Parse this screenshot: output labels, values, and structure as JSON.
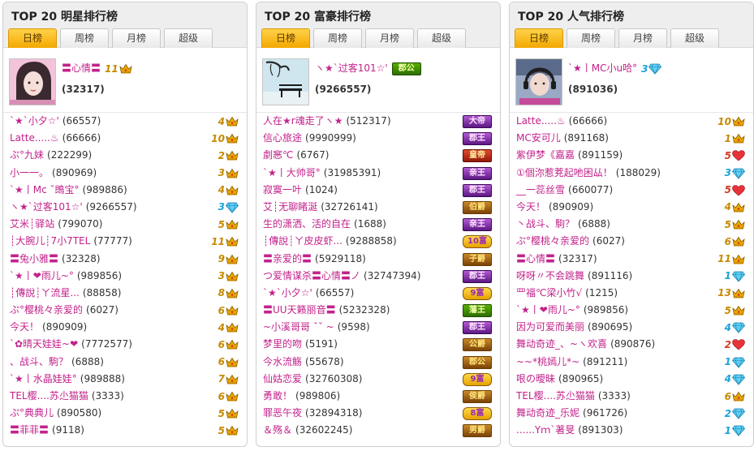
{
  "panels": [
    {
      "title": "TOP 20 明星排行榜",
      "tabs": [
        "日榜",
        "周榜",
        "月榜",
        "超级"
      ],
      "active_tab": 0,
      "top": {
        "name": "〓心情〓",
        "score": "(32317)",
        "level": "11",
        "badge_icon": "crown-icon",
        "avatar": "avatar-girl-pink"
      },
      "rows": [
        {
          "name": "`★`小夕☆'",
          "score": "(66557)",
          "level": "4",
          "icon": "crown-icon"
        },
        {
          "name": "Latte.....♨",
          "score": "(66666)",
          "level": "10",
          "icon": "crown-icon"
        },
        {
          "name": "ぷ°九妹",
          "score": "(222299)",
          "level": "2",
          "icon": "crown-icon"
        },
        {
          "name": "小一一。",
          "score": "(890969)",
          "level": "3",
          "icon": "crown-icon"
        },
        {
          "name": "`★丨Mc ˇ鵖宝°",
          "score": "(989886)",
          "level": "4",
          "icon": "crown-icon"
        },
        {
          "name": "ヽ★`过客101☆'",
          "score": "(9266557)",
          "level": "3",
          "icon": "diamond-icon"
        },
        {
          "name": "艾米┊驿站",
          "score": "(799070)",
          "level": "5",
          "icon": "crown-icon"
        },
        {
          "name": "┊大腕儿┊7小7TEL",
          "score": "(77777)",
          "level": "11",
          "icon": "crown-icon"
        },
        {
          "name": "〓兔小雅〓",
          "score": "(32328)",
          "level": "9",
          "icon": "crown-icon"
        },
        {
          "name": "`★丨❤雨儿~°",
          "score": "(989856)",
          "level": "3",
          "icon": "crown-icon"
        },
        {
          "name": "┊傳說┊ㄚ流星...",
          "score": "(88858)",
          "level": "8",
          "icon": "crown-icon"
        },
        {
          "name": "ぷ°樱桃々亲爱的",
          "score": "(6027)",
          "level": "6",
          "icon": "crown-icon"
        },
        {
          "name": "今天！",
          "score": "(890909)",
          "level": "4",
          "icon": "crown-icon"
        },
        {
          "name": "`✿晴天娃娃~❤",
          "score": "(7772577)",
          "level": "6",
          "icon": "crown-icon"
        },
        {
          "name": "、战斗、駒？",
          "score": "(6888)",
          "level": "6",
          "icon": "crown-icon"
        },
        {
          "name": "`★丨水晶娃娃°",
          "score": "(989888)",
          "level": "7",
          "icon": "crown-icon"
        },
        {
          "name": "TEL樱....苏尐猫猫",
          "score": "(3333)",
          "level": "6",
          "icon": "crown-icon"
        },
        {
          "name": "ぷ°典典儿",
          "score": "(890580)",
          "level": "5",
          "icon": "crown-icon"
        },
        {
          "name": "〓菲菲〓",
          "score": "(9118)",
          "level": "5",
          "icon": "crown-icon"
        }
      ]
    },
    {
      "title": "TOP 20 富豪排行榜",
      "tabs": [
        "日榜",
        "周榜",
        "月榜",
        "超级"
      ],
      "active_tab": 0,
      "top": {
        "name": "ヽ★`过客101☆'",
        "score": "(9266557)",
        "title_badge": "郡公",
        "badge_style": "green",
        "avatar": "avatar-bench-tree"
      },
      "rows": [
        {
          "name": "人在★r魂走了ヽ★",
          "score": "(512317)",
          "badge": "大帝",
          "style": "purple"
        },
        {
          "name": "信心旅途",
          "score": "(9990999)",
          "badge": "郡王",
          "style": "purple"
        },
        {
          "name": "劇窸℃",
          "score": "(6767)",
          "badge": "皇帝",
          "style": "red"
        },
        {
          "name": "`★丨大帅哥°",
          "score": "(31985391)",
          "badge": "亲王",
          "style": "purple"
        },
        {
          "name": "寂寞一叶",
          "score": "(1024)",
          "badge": "郡王",
          "style": "purple"
        },
        {
          "name": "艾┊无聊睹涎",
          "score": "(32726141)",
          "badge": "伯爵",
          "style": "brown"
        },
        {
          "name": "生的潇洒、活的自在",
          "score": "(1688)",
          "badge": "亲王",
          "style": "purple"
        },
        {
          "name": "┊傳說┊ㄚ皮皮虾...",
          "score": "(9288858)",
          "badge": "10富",
          "style": "fancy"
        },
        {
          "name": "〓亲爱的〓",
          "score": "(5929118)",
          "badge": "子爵",
          "style": "brown"
        },
        {
          "name": "つ爱情谋杀〓心情〓ノ",
          "score": "(32747394)",
          "badge": "郡王",
          "style": "purple"
        },
        {
          "name": "`★`小夕☆'",
          "score": "(66557)",
          "badge": "9富",
          "style": "fancy"
        },
        {
          "name": "〓UU天籁丽音〓",
          "score": "(5232328)",
          "badge": "藩王",
          "style": "green"
        },
        {
          "name": "~小溪哥哥 ˇˇ ~",
          "score": "(9598)",
          "badge": "郡王",
          "style": "purple"
        },
        {
          "name": "梦里的吻",
          "score": "(5191)",
          "badge": "公爵",
          "style": "brown"
        },
        {
          "name": "今水流觞",
          "score": "(55678)",
          "badge": "郡公",
          "style": "brown"
        },
        {
          "name": "仙姑恋爱",
          "score": "(32760308)",
          "badge": "9富",
          "style": "fancy"
        },
        {
          "name": "勇敢！",
          "score": "(989806)",
          "badge": "侯爵",
          "style": "brown"
        },
        {
          "name": "罪恶午夜",
          "score": "(32894318)",
          "badge": "8富",
          "style": "fancy"
        },
        {
          "name": "＆殇＆",
          "score": "(32602245)",
          "badge": "男爵",
          "style": "brown"
        }
      ]
    },
    {
      "title": "TOP 20 人气排行榜",
      "tabs": [
        "日榜",
        "周榜",
        "月榜",
        "超级"
      ],
      "active_tab": 0,
      "top": {
        "name": "`★丨MC小u哈°",
        "score": "(891036)",
        "level": "3",
        "badge_icon": "diamond-icon",
        "avatar": "avatar-girl-headphones"
      },
      "rows": [
        {
          "name": "Latte.....♨",
          "score": "(66666)",
          "level": "10",
          "icon": "crown-icon"
        },
        {
          "name": "MC安可儿",
          "score": "(891168)",
          "level": "1",
          "icon": "crown-icon"
        },
        {
          "name": "紫伊梦《嘉嘉",
          "score": "(891159)",
          "level": "5",
          "icon": "heart-icon"
        },
        {
          "name": "①個沵惹茺起吔困厸！",
          "score": "(188029)",
          "level": "3",
          "icon": "diamond-icon"
        },
        {
          "name": "__一蕊丝雪",
          "score": "(660077)",
          "level": "5",
          "icon": "heart-icon"
        },
        {
          "name": "今天！",
          "score": "(890909)",
          "level": "4",
          "icon": "crown-icon"
        },
        {
          "name": "丶战斗、駒？",
          "score": "(6888)",
          "level": "5",
          "icon": "crown-icon"
        },
        {
          "name": "ぷ°樱桃々亲爱的",
          "score": "(6027)",
          "level": "6",
          "icon": "crown-icon"
        },
        {
          "name": "〓心情〓",
          "score": "(32317)",
          "level": "11",
          "icon": "crown-icon"
        },
        {
          "name": "呀呀〃不会跳舞",
          "score": "(891116)",
          "level": "1",
          "icon": "diamond-icon"
        },
        {
          "name": "罒福℃梁小竹√",
          "score": "(1215)",
          "level": "13",
          "icon": "crown-icon"
        },
        {
          "name": "`★丨❤雨儿~°",
          "score": "(989856)",
          "level": "5",
          "icon": "crown-icon"
        },
        {
          "name": "因为可爱而美丽",
          "score": "(890695)",
          "level": "4",
          "icon": "diamond-icon"
        },
        {
          "name": "舞动奇迹_、~ヽ欢喜",
          "score": "(890876)",
          "level": "2",
          "icon": "heart-icon"
        },
        {
          "name": "~~*桃嫣儿*~",
          "score": "(891211)",
          "level": "1",
          "icon": "diamond-icon"
        },
        {
          "name": "哏の曖昧",
          "score": "(890965)",
          "level": "4",
          "icon": "diamond-icon"
        },
        {
          "name": "TEL樱....苏尐猫猫",
          "score": "(3333)",
          "level": "6",
          "icon": "crown-icon"
        },
        {
          "name": "舞动奇迹_乐妮",
          "score": "(961726)",
          "level": "2",
          "icon": "diamond-icon"
        },
        {
          "name": "......Yｍ`著旻",
          "score": "(891303)",
          "level": "1",
          "icon": "diamond-icon"
        }
      ]
    }
  ]
}
